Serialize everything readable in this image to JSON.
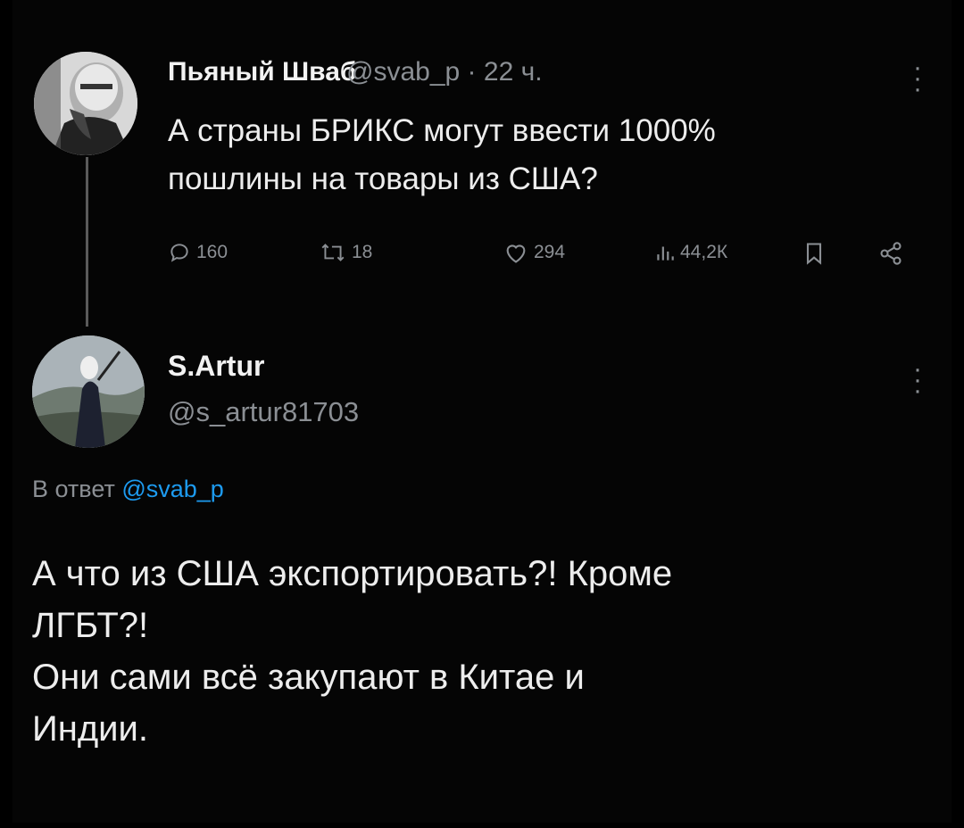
{
  "tweet": {
    "author_name": "Пьяный Шваб",
    "handle": "@svab_p",
    "separator": "·",
    "time": "22 ч.",
    "text_lines": [
      "А страны БРИКС могут ввести 1000%",
      "пошлины на товары из США?"
    ],
    "stats": {
      "replies": "160",
      "retweets": "18",
      "likes": "294",
      "views": "44,2К"
    }
  },
  "reply": {
    "author_name": "S.Artur",
    "handle": "@s_artur81703",
    "reply_prefix": "В ответ",
    "reply_to_handle": "@svab_p",
    "text_lines": [
      "А что из США экспортировать?! Кроме",
      "ЛГБТ?!",
      "Они сами всё закупают в Китае и",
      "Индии."
    ]
  },
  "icons": {
    "reply": "reply-icon",
    "retweet": "retweet-icon",
    "like": "heart-icon",
    "views": "views-icon",
    "bookmark": "bookmark-icon",
    "share": "share-icon",
    "more": "more-icon"
  },
  "colors": {
    "background": "#000000",
    "text": "#e7e9ea",
    "muted": "#8b8f94",
    "link": "#1d9bf0"
  }
}
